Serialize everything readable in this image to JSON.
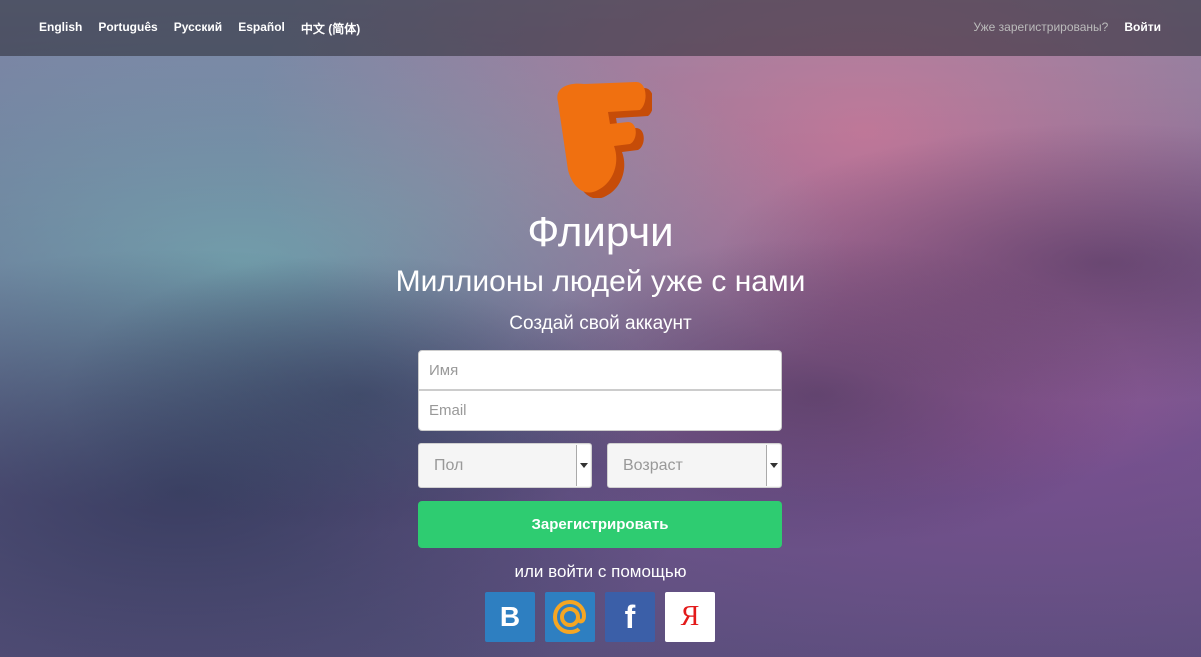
{
  "languages": [
    "English",
    "Português",
    "Русский",
    "Español",
    "中文 (简体)"
  ],
  "auth": {
    "question": "Уже зарегистрированы?",
    "login": "Войти"
  },
  "brand": {
    "name": "Флирчи",
    "tagline": "Миллионы людей уже с нами",
    "subtitle": "Создай свой аккаунт"
  },
  "form": {
    "name_placeholder": "Имя",
    "email_placeholder": "Email",
    "gender_value": "Пол",
    "age_value": "Возраст",
    "register_label": "Зарегистрировать"
  },
  "social": {
    "label": "или войти с помощью",
    "vk_glyph": "B",
    "fb_glyph": "f",
    "ya_glyph": "Я"
  },
  "colors": {
    "accent": "#2ecc71",
    "logo": "#f07010"
  }
}
